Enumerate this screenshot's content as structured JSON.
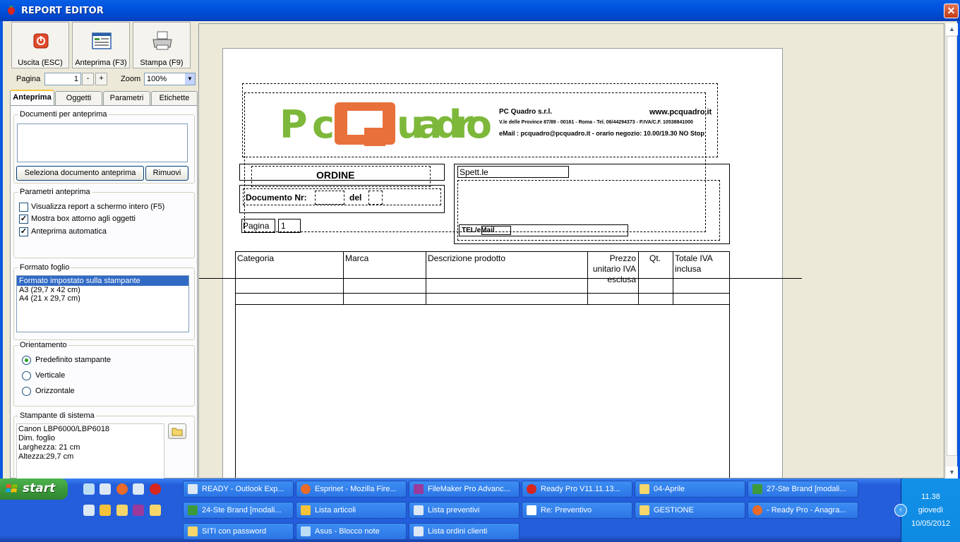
{
  "window": {
    "title": "REPORT EDITOR",
    "close_label": "✕"
  },
  "toolbar": {
    "exit_label": "Uscita (ESC)",
    "preview_label": "Anteprima (F3)",
    "print_label": "Stampa (F9)",
    "page_label": "Pagina",
    "page_value": "1",
    "minus_label": "-",
    "plus_label": "+",
    "zoom_label": "Zoom",
    "zoom_value": "100%"
  },
  "tabs": [
    "Anteprima",
    "Oggetti",
    "Parametri",
    "Etichette"
  ],
  "preview_tab": {
    "docs_legend": "Documenti per anteprima",
    "select_button": "Seleziona documento anteprima",
    "remove_button": "Rimuovi",
    "params_legend": "Parametri anteprima",
    "options": [
      {
        "label": "Visualizza report a schermo intero (F5)",
        "checked": false
      },
      {
        "label": "Mostra box attorno agli oggetti",
        "checked": true
      },
      {
        "label": "Anteprima automatica",
        "checked": true
      }
    ],
    "format_legend": "Formato foglio",
    "formats": [
      "Formato impostato sulla stampante",
      "A3 (29,7 x 42 cm)",
      "A4 (21 x 29,7 cm)"
    ],
    "orientation_legend": "Orientamento",
    "orientations": [
      {
        "label": "Predefinito stampante",
        "selected": true
      },
      {
        "label": "Verticale",
        "selected": false
      },
      {
        "label": "Orizzontale",
        "selected": false
      }
    ],
    "printer_legend": "Stampante di sistema",
    "printer_lines": [
      "Canon LBP6000/LBP6018",
      "Dim. foglio",
      "Larghezza: 21 cm",
      "Altezza:29,7 cm"
    ]
  },
  "sheet": {
    "logo_text": "PcQuadro",
    "company_name": "PC Quadro s.r.l.",
    "website": "www.pcquadro.it",
    "address": "V.le delle Province 87/89 - 00161 - Roma - Tel. 06/44294373 - P.IVA/C.F. 10538841000",
    "email_line": "eMail : pcquadro@pcquadro.it  - orario negozio: 10.00/19.30 NO Stop",
    "order_title": "ORDINE",
    "doc_nr_label": "Documento Nr:",
    "del_label": "del",
    "page_label": "Pagina",
    "page_value": "1",
    "recipient_label": "Spett.le",
    "tel_label": "TEL/eMail",
    "columns": [
      "Categoria",
      "Marca",
      "Descrizione prodotto",
      "Prezzo unitario IVA esclusa",
      "Qt.",
      "Totale IVA inclusa"
    ]
  },
  "taskbar": {
    "start_label": "start",
    "tasks_row1": [
      "READY - Outlook Exp...",
      "Esprinet - Mozilla Fire...",
      "FileMaker Pro Advanc...",
      "Ready Pro V11.11.13...",
      "04-Aprile",
      "27-Ste Brand  [modali..."
    ],
    "tasks_row2": [
      "24-Ste Brand  [modali...",
      "Lista articoli",
      "Lista preventivi",
      "Re: Preventivo",
      "GESTIONE",
      "- Ready Pro - Anagra..."
    ],
    "tasks_row3": [
      "SITI con password",
      "Asus - Blocco note",
      "Lista ordini clienti"
    ],
    "clock_time": "11.38",
    "clock_day": "giovedì",
    "clock_date": "10/05/2012"
  },
  "colors": {
    "titlebar": "#0054E3",
    "accent_logo_green": "#7DB83A",
    "accent_logo_orange": "#E8703A"
  }
}
